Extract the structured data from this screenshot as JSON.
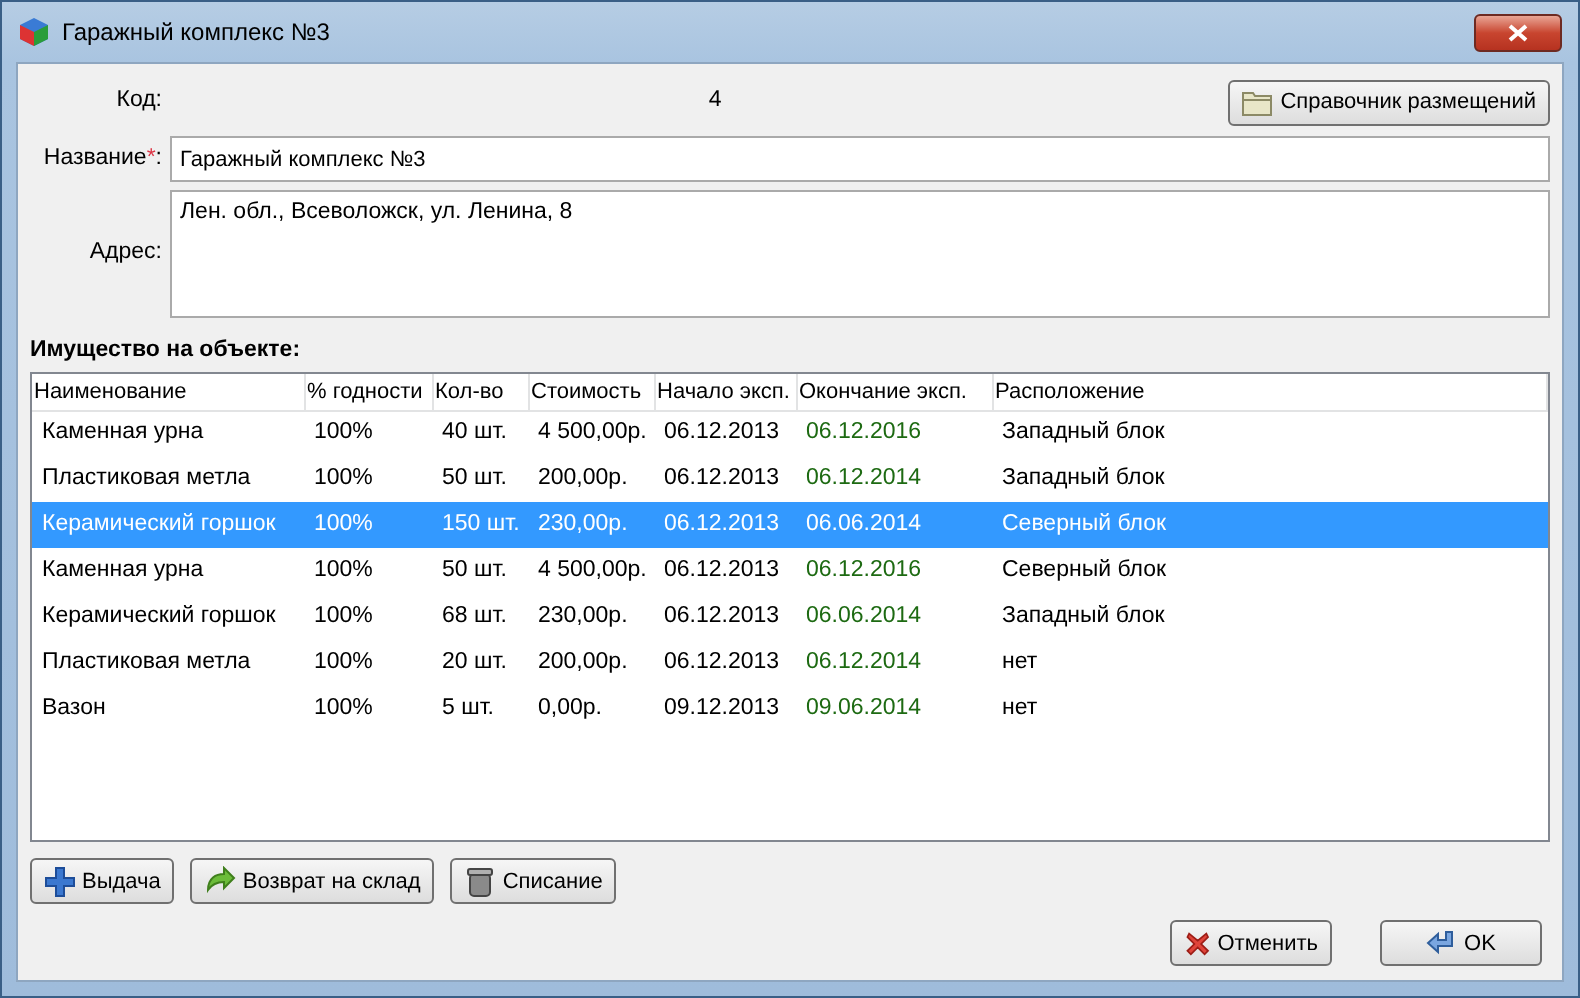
{
  "window": {
    "title": "Гаражный комплекс №3"
  },
  "code": {
    "label": "Код:",
    "value": "4"
  },
  "directory_button": "Справочник размещений",
  "name": {
    "label": "Название",
    "required_mark": "*",
    "colon": ":",
    "value": "Гаражный комплекс №3"
  },
  "address": {
    "label": "Адрес:",
    "value": "Лен. обл., Всеволожск, ул. Ленина, 8"
  },
  "property_title": "Имущество на объекте:",
  "table": {
    "columns": [
      "Наименование",
      "% годности",
      "Кол-во",
      "Стоимость",
      "Начало эксп.",
      "Окончание эксп.",
      "Расположение"
    ],
    "rows": [
      {
        "cells": [
          "Каменная урна",
          "100%",
          "40 шт.",
          "4 500,00р.",
          "06.12.2013",
          "06.12.2016",
          "Западный блок"
        ],
        "selected": false
      },
      {
        "cells": [
          "Пластиковая метла",
          "100%",
          "50 шт.",
          "200,00р.",
          "06.12.2013",
          "06.12.2014",
          "Западный блок"
        ],
        "selected": false
      },
      {
        "cells": [
          "Керамический горшок",
          "100%",
          "150 шт.",
          "230,00р.",
          "06.12.2013",
          "06.06.2014",
          "Северный блок"
        ],
        "selected": true
      },
      {
        "cells": [
          "Каменная урна",
          "100%",
          "50 шт.",
          "4 500,00р.",
          "06.12.2013",
          "06.12.2016",
          "Северный блок"
        ],
        "selected": false
      },
      {
        "cells": [
          "Керамический горшок",
          "100%",
          "68 шт.",
          "230,00р.",
          "06.12.2013",
          "06.06.2014",
          "Западный блок"
        ],
        "selected": false
      },
      {
        "cells": [
          "Пластиковая метла",
          "100%",
          "20 шт.",
          "200,00р.",
          "06.12.2013",
          "06.12.2014",
          "нет"
        ],
        "selected": false
      },
      {
        "cells": [
          "Вазон",
          "100%",
          "5 шт.",
          "0,00р.",
          "09.12.2013",
          "09.06.2014",
          "нет"
        ],
        "selected": false
      }
    ]
  },
  "actions": [
    {
      "kind": "plus",
      "label": "Выдача"
    },
    {
      "kind": "return",
      "label": "Возврат на склад"
    },
    {
      "kind": "bin",
      "label": "Списание"
    }
  ],
  "dialog_buttons": [
    {
      "kind": "cancel",
      "label": "Отменить"
    },
    {
      "kind": "ok",
      "label": "OK"
    }
  ]
}
